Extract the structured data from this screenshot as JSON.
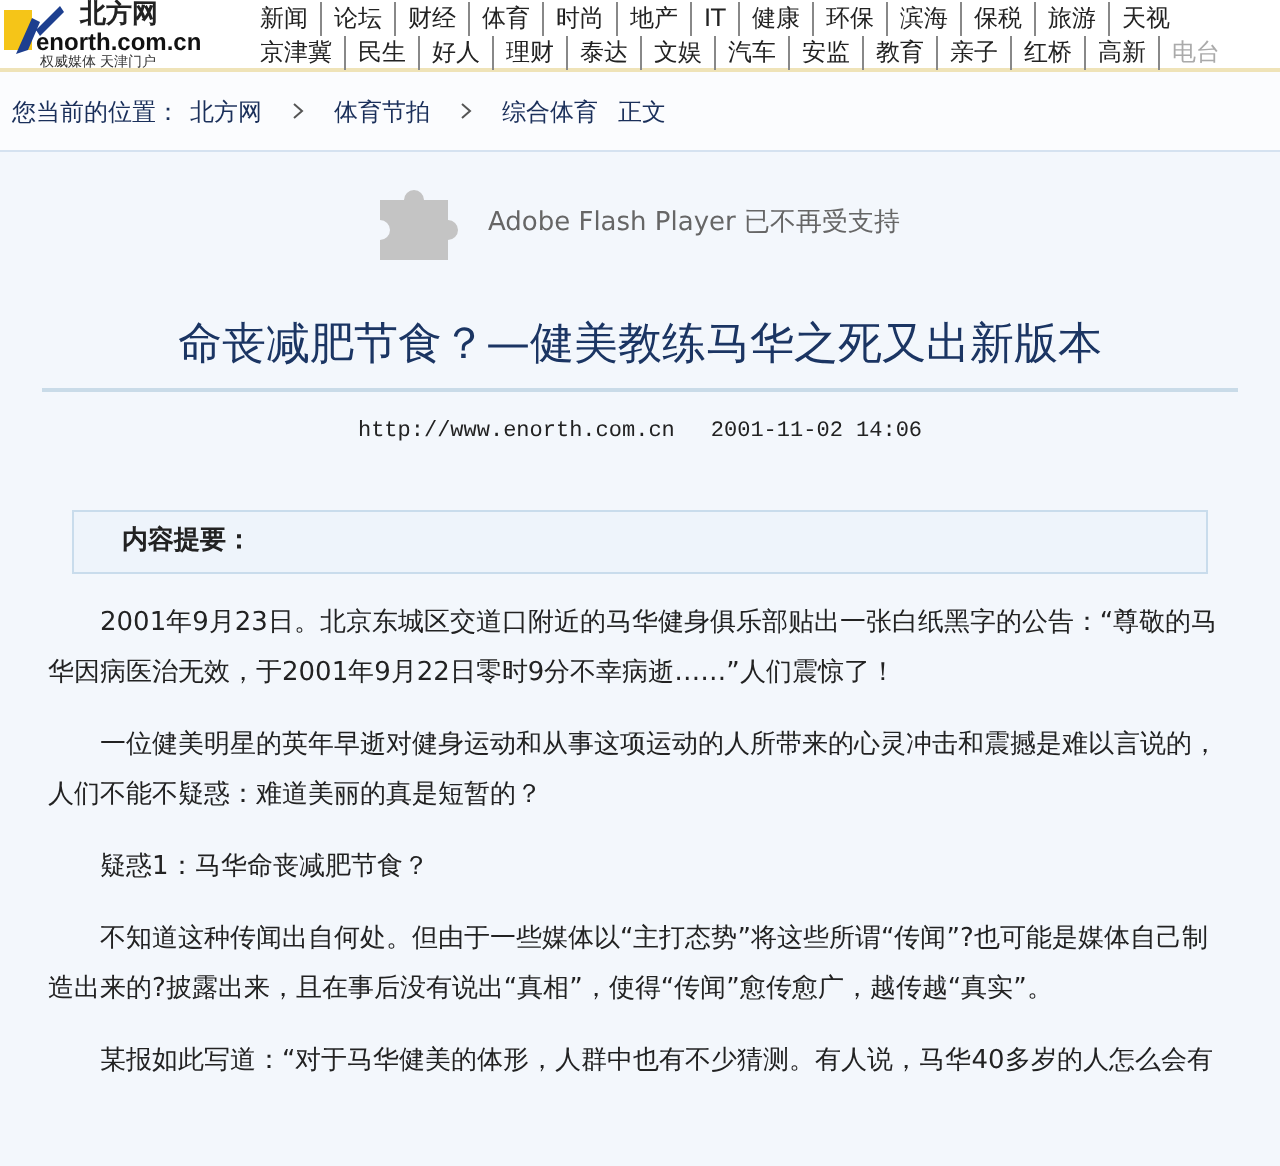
{
  "header": {
    "logo": {
      "name": "北方网",
      "domain": "enorth.com.cn",
      "slogan": "权威媒体 天津门户"
    },
    "nav_rows": [
      [
        {
          "label": "新闻",
          "disabled": false
        },
        {
          "label": "论坛",
          "disabled": false
        },
        {
          "label": "财经",
          "disabled": false
        },
        {
          "label": "体育",
          "disabled": false
        },
        {
          "label": "时尚",
          "disabled": false
        },
        {
          "label": "地产",
          "disabled": false
        },
        {
          "label": "IT",
          "disabled": false
        },
        {
          "label": "健康",
          "disabled": false
        },
        {
          "label": "环保",
          "disabled": false
        },
        {
          "label": "滨海",
          "disabled": false
        },
        {
          "label": "保税",
          "disabled": false
        },
        {
          "label": "旅游",
          "disabled": false
        },
        {
          "label": "天视",
          "disabled": false
        }
      ],
      [
        {
          "label": "京津冀",
          "disabled": false
        },
        {
          "label": "民生",
          "disabled": false
        },
        {
          "label": "好人",
          "disabled": false
        },
        {
          "label": "理财",
          "disabled": false
        },
        {
          "label": "泰达",
          "disabled": false
        },
        {
          "label": "文娱",
          "disabled": false
        },
        {
          "label": "汽车",
          "disabled": false
        },
        {
          "label": "安监",
          "disabled": false
        },
        {
          "label": "教育",
          "disabled": false
        },
        {
          "label": "亲子",
          "disabled": false
        },
        {
          "label": "红桥",
          "disabled": false
        },
        {
          "label": "高新",
          "disabled": false
        },
        {
          "label": "电台",
          "disabled": true
        }
      ]
    ]
  },
  "breadcrumb": {
    "label": "您当前的位置：",
    "items": [
      {
        "label": "北方网",
        "chevron_after": true
      },
      {
        "label": "体育节拍",
        "chevron_after": true
      },
      {
        "label": "综合体育",
        "chevron_after": false
      },
      {
        "label": "正文",
        "chevron_after": false
      }
    ]
  },
  "flash_notice": "Adobe Flash Player 已不再受支持",
  "article": {
    "title": "命丧减肥节食？—健美教练马华之死又出新版本",
    "url": "http://www.enorth.com.cn",
    "date": "2001-11-02 14:06",
    "summary_label": "内容提要：",
    "paragraphs": [
      "2001年9月23日。北京东城区交道口附近的马华健身俱乐部贴出一张白纸黑字的公告：“尊敬的马华因病医治无效，于2001年9月22日零时9分不幸病逝……”人们震惊了！",
      "一位健美明星的英年早逝对健身运动和从事这项运动的人所带来的心灵冲击和震撼是难以言说的，人们不能不疑惑：难道美丽的真是短暂的？",
      "疑惑1：马华命丧减肥节食？",
      "不知道这种传闻出自何处。但由于一些媒体以“主打态势”将这些所谓“传闻”?也可能是媒体自己制造出来的?披露出来，且在事后没有说出“真相”，使得“传闻”愈传愈广，越传越“真实”。",
      "某报如此写道：“对于马华健美的体形，人群中也有不少猜测。有人说，马华40多岁的人怎么会有"
    ]
  }
}
